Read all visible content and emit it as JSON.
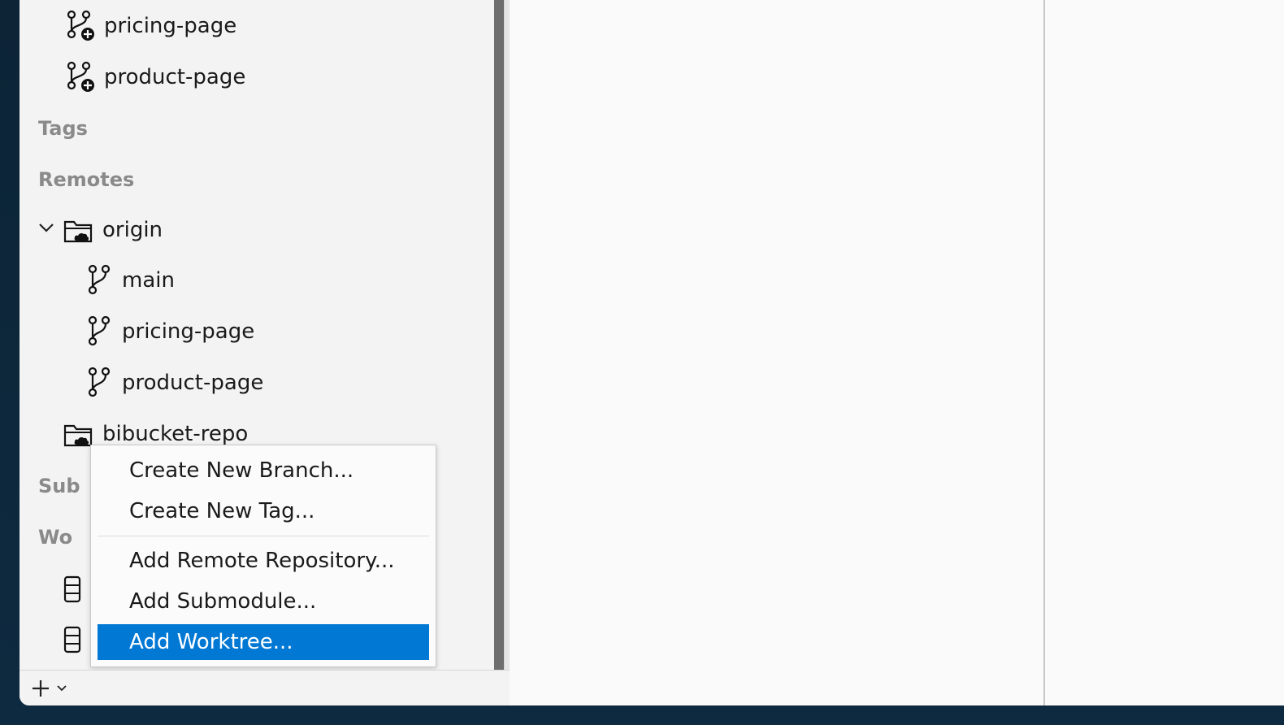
{
  "sidebar": {
    "local_branches": [
      {
        "label": "pricing-page",
        "icon": "branch-add-icon"
      },
      {
        "label": "product-page",
        "icon": "branch-add-icon"
      }
    ],
    "sections": {
      "tags": "Tags",
      "remotes": "Remotes",
      "submodules_partial": "Sub",
      "worktrees_partial": "Wo"
    },
    "remotes": [
      {
        "label": "origin",
        "icon": "cloud-folder-icon",
        "expanded": true,
        "branches": [
          {
            "label": "main",
            "icon": "branch-icon"
          },
          {
            "label": "pricing-page",
            "icon": "branch-icon"
          },
          {
            "label": "product-page",
            "icon": "branch-icon"
          }
        ]
      },
      {
        "label": "bibucket-repo",
        "icon": "cloud-folder-icon",
        "expanded": false
      }
    ]
  },
  "context_menu": {
    "items": [
      {
        "label": "Create New Branch..."
      },
      {
        "label": "Create New Tag..."
      },
      {
        "label": "Add Remote Repository..."
      },
      {
        "label": "Add Submodule..."
      },
      {
        "label": "Add Worktree...",
        "highlighted": true
      }
    ]
  },
  "bottom_bar": {
    "add_icon": "plus-icon",
    "dropdown_icon": "chevron-down-icon"
  },
  "colors": {
    "accent": "#0078d4",
    "sidebar_bg": "#f3f3f3",
    "section_label": "#8a8a8a"
  }
}
